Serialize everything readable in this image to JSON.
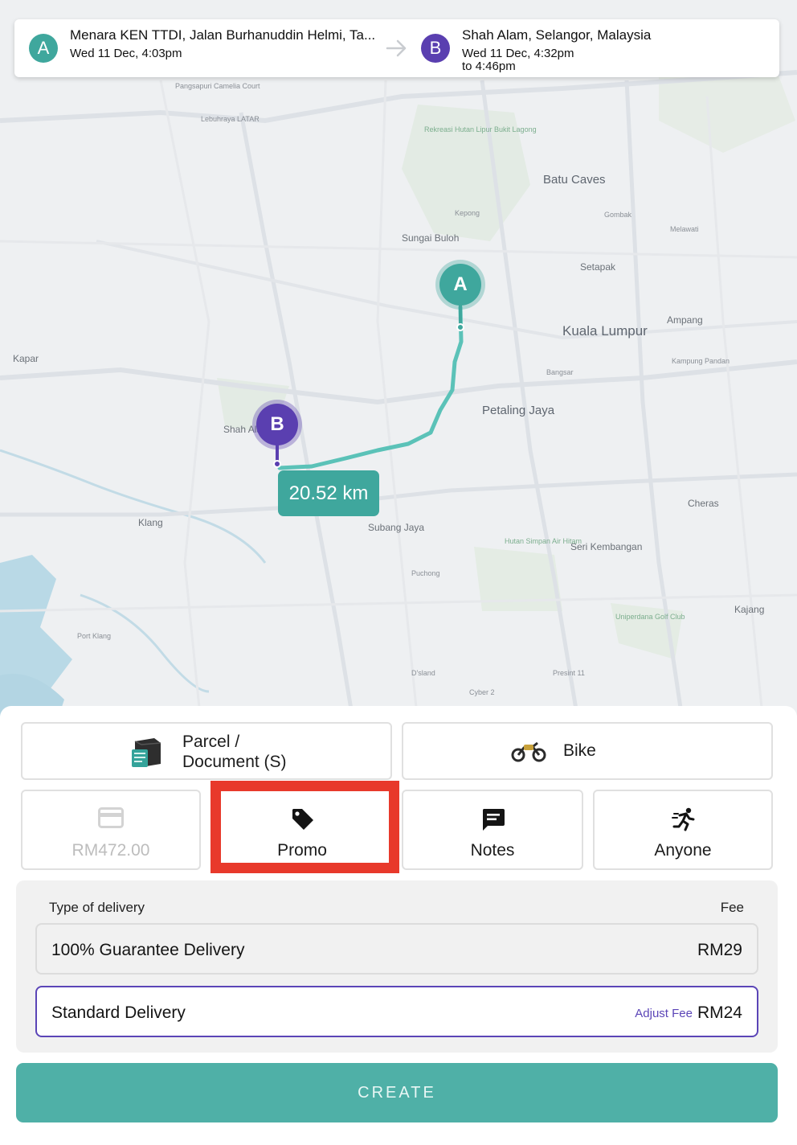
{
  "colors": {
    "accent_teal": "#3fa79d",
    "accent_purple": "#5a3fb0",
    "highlight_red": "#e8392b",
    "create_button": "#4fb0a7"
  },
  "route": {
    "origin": {
      "badge": "A",
      "address": "Menara KEN TTDI, Jalan Burhanuddin Helmi, Ta...",
      "time": "Wed 11 Dec, 4:03pm"
    },
    "destination": {
      "badge": "B",
      "address": "Shah Alam, Selangor, Malaysia",
      "time": "Wed 11 Dec, 4:32pm",
      "time_to": "to 4:46pm"
    }
  },
  "map": {
    "pin_a": "A",
    "pin_b": "B",
    "distance": "20.52 km",
    "labels": {
      "batu_caves": "Batu Caves",
      "kuala_lumpur": "Kuala Lumpur",
      "petaling_jaya": "Petaling Jaya",
      "shah_alam": "Shah Alam",
      "subang_jaya": "Subang Jaya",
      "klang": "Klang",
      "kapar": "Kapar",
      "cheras": "Cheras",
      "ampang": "Ampang",
      "setapak": "Setapak",
      "kajang": "Kajang",
      "sungai_buloh": "Sungai Buloh",
      "seri_kembangan": "Seri Kembangan",
      "gombak": "Gombak",
      "melawati": "Melawati",
      "bangsar": "Bangsar",
      "kepong": "Kepong",
      "lebuhraya_latar": "Lebuhraya LATAR",
      "kampung_pandan": "Kampung Pandan",
      "puchong": "Puchong",
      "pangsapuri": "Pangsapuri Camelia Court",
      "port_klang": "Port Klang",
      "putrajaya_hint": "Cyber 2",
      "presint": "Presint 11",
      "dsland": "D'sland",
      "uniperdana": "Uniperdana Golf Club",
      "rekreasi": "Rekreasi Hutan Lipur Bukit Lagong",
      "hutan_simpan": "Hutan Simpan Air Hitam"
    }
  },
  "options": {
    "package": "Parcel / Document (S)",
    "package_line1": "Parcel /",
    "package_line2": "Document (S)",
    "vehicle": "Bike",
    "price": "RM472.00",
    "promo": "Promo",
    "notes": "Notes",
    "driver": "Anyone"
  },
  "icons": {
    "package": "parcel-box-icon",
    "vehicle": "motorbike-icon",
    "price": "credit-card-icon",
    "promo": "tag-icon",
    "notes": "message-icon",
    "driver": "running-person-icon",
    "arrow": "arrow-right-icon"
  },
  "delivery": {
    "type_header": "Type of delivery",
    "fee_header": "Fee",
    "options": [
      {
        "name": "100% Guarantee Delivery",
        "fee": "RM29",
        "selected": false
      },
      {
        "name": "Standard Delivery",
        "fee": "RM24",
        "selected": true,
        "adjust_label": "Adjust Fee"
      }
    ]
  },
  "create_label": "CREATE"
}
